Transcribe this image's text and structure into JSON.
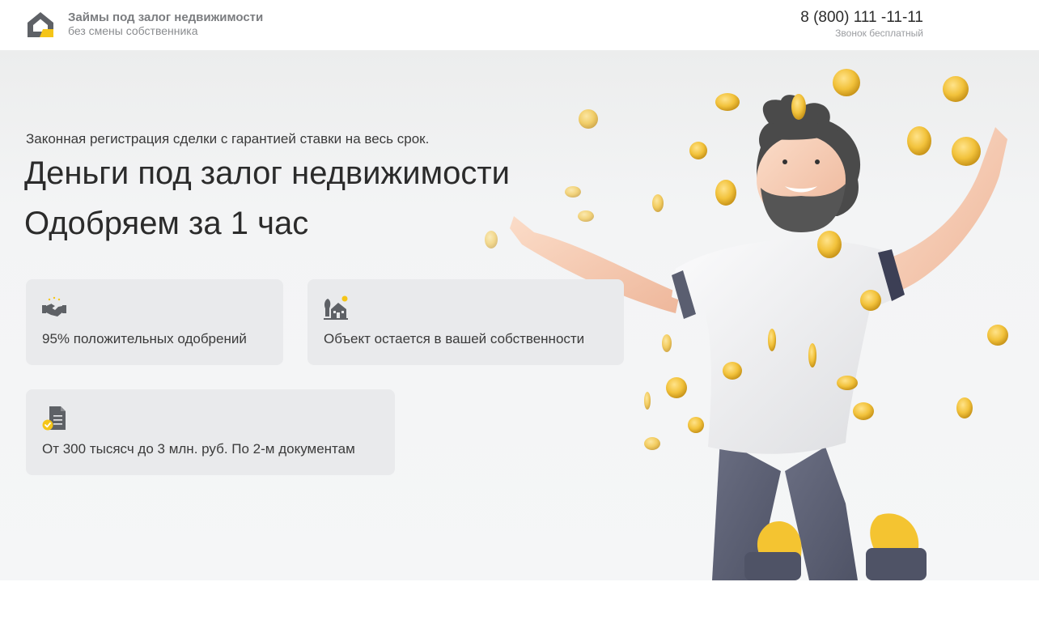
{
  "header": {
    "brand_title": "Займы под залог недвижимости",
    "brand_subtitle": "без смены собственника",
    "phone": "8 (800) 111 -11-11",
    "phone_note": "Звонок бесплатный"
  },
  "hero": {
    "tagline": "Законная регистрация сделки с гарантией ставки на весь срок.",
    "title_line1": "Деньги под залог недвижимости",
    "title_line2": "Одобряем за 1 час"
  },
  "features": [
    {
      "icon": "handshake-icon",
      "text": "95% положительных одобрений"
    },
    {
      "icon": "house-icon",
      "text": "Объект остается в вашей собственности"
    },
    {
      "icon": "document-check-icon",
      "text": "От 300 тысясч до 3 млн. руб. По 2-м документам"
    }
  ],
  "colors": {
    "accent_yellow": "#f5c518",
    "logo_gray": "#5e6166",
    "card_bg": "#e9eaec",
    "text_dark": "#2b2b2b"
  }
}
